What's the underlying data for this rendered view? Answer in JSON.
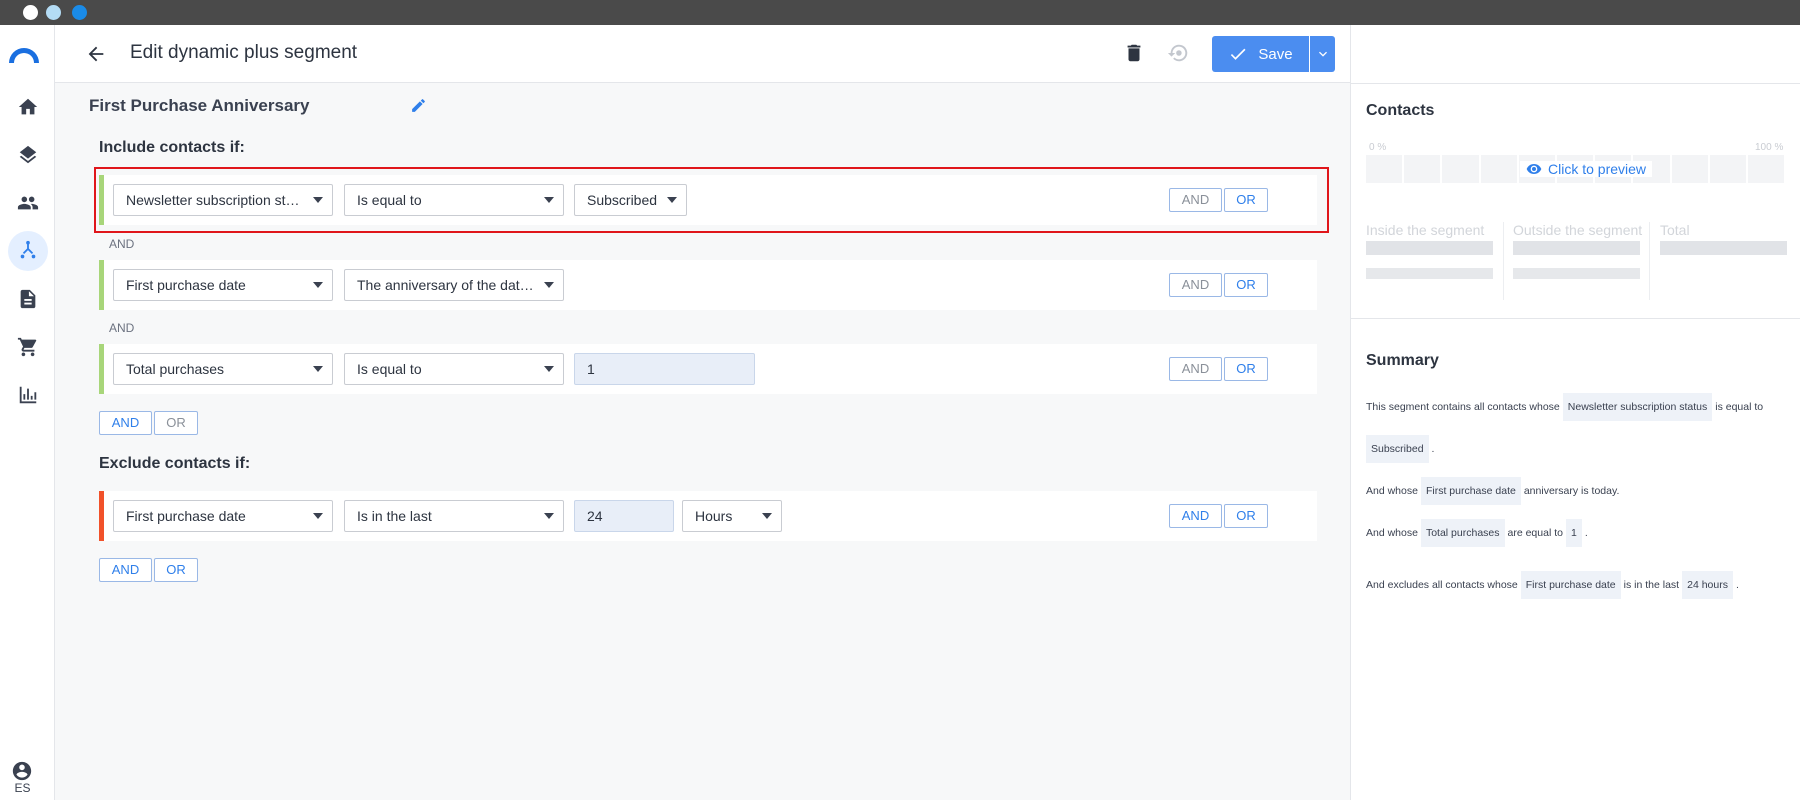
{
  "window": {
    "dots": [
      "#ffffff",
      "#b4dcf5",
      "#1a8be8"
    ]
  },
  "sidebar": {
    "items": [
      {
        "icon": "home-icon"
      },
      {
        "icon": "layers-icon"
      },
      {
        "icon": "people-icon"
      },
      {
        "icon": "segments-icon",
        "active": true
      },
      {
        "icon": "document-icon"
      },
      {
        "icon": "cart-icon"
      },
      {
        "icon": "chart-icon"
      }
    ],
    "language": "ES"
  },
  "header": {
    "title": "Edit dynamic plus segment",
    "save_label": "Save"
  },
  "segment": {
    "name": "First Purchase Anniversary"
  },
  "include": {
    "title": "Include contacts if:",
    "rules": [
      {
        "field": "Newsletter subscription status",
        "operator": "Is equal to",
        "value": "Subscribed"
      },
      {
        "field": "First purchase date",
        "operator": "The anniversary of the date is today"
      },
      {
        "field": "Total purchases",
        "operator": "Is equal to",
        "value": "1"
      }
    ],
    "connectors": [
      "AND",
      "AND"
    ]
  },
  "exclude": {
    "title": "Exclude contacts if:",
    "rules": [
      {
        "field": "First purchase date",
        "operator": "Is in the last",
        "value": "24",
        "unit": "Hours"
      }
    ]
  },
  "buttons": {
    "and": "AND",
    "or": "OR"
  },
  "contacts": {
    "title": "Contacts",
    "pct_min": "0 %",
    "pct_max": "100 %",
    "preview": "Click to preview",
    "inside": "Inside the segment",
    "outside": "Outside the segment",
    "total": "Total"
  },
  "summary": {
    "title": "Summary",
    "l1_a": "This segment contains all contacts whose",
    "l1_chip": "Newsletter subscription status",
    "l1_b": "is equal to",
    "l2_chip": "Subscribed",
    "l2_b": ".",
    "l3_a": "And whose",
    "l3_chip": "First purchase date",
    "l3_b": "anniversary is today.",
    "l4_a": "And whose",
    "l4_chip": "Total purchases",
    "l4_b": "are equal to",
    "l4_chip2": "1",
    "l4_c": ".",
    "l5_a": "And excludes all contacts whose",
    "l5_chip": "First purchase date",
    "l5_b": "is in the last",
    "l5_chip2": "24 hours",
    "l5_c": "."
  }
}
